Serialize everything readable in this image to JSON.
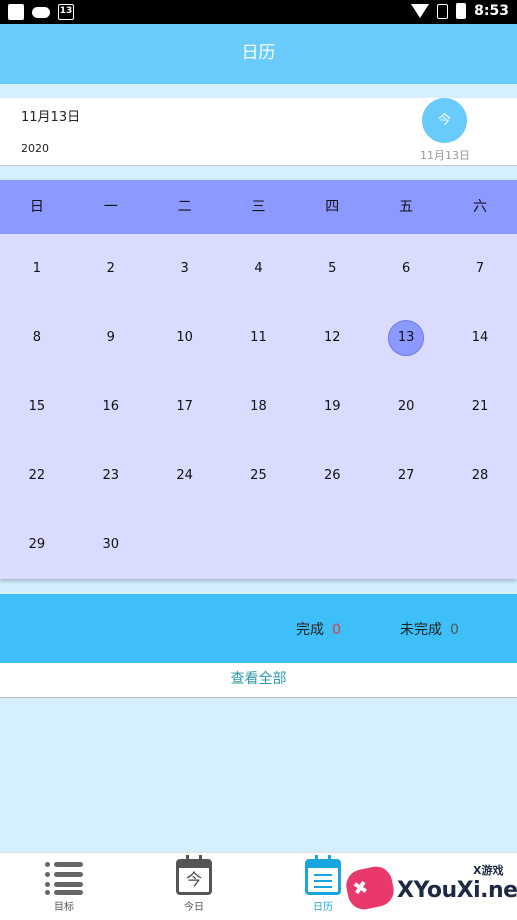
{
  "status_bar": {
    "calendar_icon_day": "13",
    "time": "8:53"
  },
  "title": "日历",
  "selected_date": {
    "month_day": "11月13日",
    "year": "2020"
  },
  "today_button": {
    "label": "今",
    "date_label": "11月13日"
  },
  "calendar": {
    "weekdays": [
      "日",
      "一",
      "二",
      "三",
      "四",
      "五",
      "六"
    ],
    "days": [
      "1",
      "2",
      "3",
      "4",
      "5",
      "6",
      "7",
      "8",
      "9",
      "10",
      "11",
      "12",
      "13",
      "14",
      "15",
      "16",
      "17",
      "18",
      "19",
      "20",
      "21",
      "22",
      "23",
      "24",
      "25",
      "26",
      "27",
      "28",
      "29",
      "30"
    ],
    "selected_day": "13",
    "accent_color": "#8c99ff"
  },
  "stats": {
    "done_label": "完成",
    "done_count": "0",
    "undone_label": "未完成",
    "undone_count": "0"
  },
  "view_all": "查看全部",
  "bottom_nav": {
    "items": [
      {
        "label": "目标",
        "icon": "list-icon"
      },
      {
        "label": "今日",
        "icon": "calendar-today-icon",
        "icon_text": "今"
      },
      {
        "label": "日历",
        "icon": "calendar-icon",
        "active": true
      }
    ],
    "active_color": "#19a6e0"
  },
  "watermark": {
    "text": "XYouXi.net",
    "small": "X游戏"
  },
  "colors": {
    "header": "#69cbfb",
    "status_band": "#3fbff8",
    "calendar_bg": "#dadcff",
    "page_bg": "#d4efff"
  }
}
